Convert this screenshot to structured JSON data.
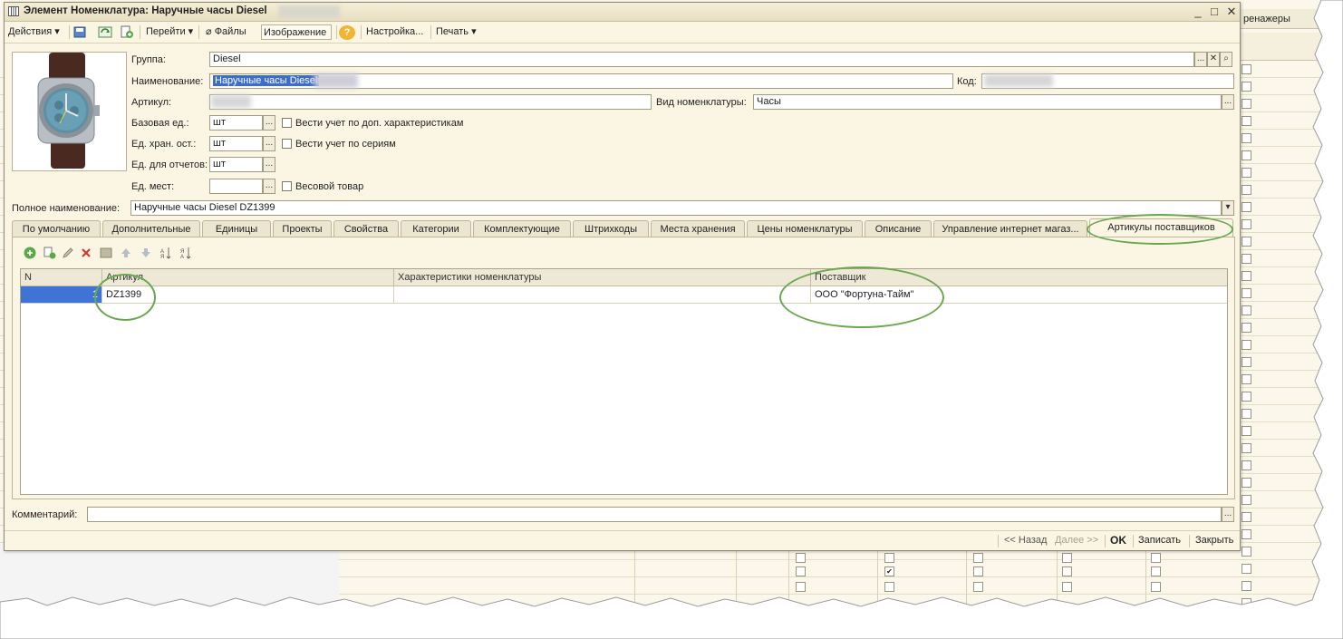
{
  "window": {
    "title": "Элемент Номенклатура: Наручные часы Diesel",
    "minimize": "_",
    "maximize": "□",
    "close": "✕"
  },
  "background": {
    "column_header": "ренажеры"
  },
  "toolbar": {
    "actions": "Действия",
    "goto": "Перейти",
    "files": "Файлы",
    "image": "Изображение",
    "help": "?",
    "settings": "Настройка...",
    "print": "Печать"
  },
  "form": {
    "group_label": "Группа:",
    "group_value": "Diesel",
    "name_label": "Наименование:",
    "name_value": "Наручные часы Diesel",
    "code_label": "Код:",
    "article_label": "Артикул:",
    "kind_label": "Вид номенклатуры:",
    "kind_value": "Часы",
    "base_unit_label": "Базовая ед.:",
    "base_unit_value": "шт",
    "storage_unit_label": "Ед. хран. ост.:",
    "storage_unit_value": "шт",
    "report_unit_label": "Ед. для отчетов:",
    "report_unit_value": "шт",
    "places_unit_label": "Ед. мест:",
    "places_unit_value": "",
    "cb_extra_chars": "Вести учет по доп. характеристикам",
    "cb_series": "Вести учет по сериям",
    "cb_weight": "Весовой товар",
    "fullname_label": "Полное наименование:",
    "fullname_value": "Наручные часы Diesel DZ1399",
    "comment_label": "Комментарий:",
    "comment_value": ""
  },
  "tabs": [
    "По умолчанию",
    "Дополнительные",
    "Единицы",
    "Проекты",
    "Свойства",
    "Категории",
    "Комплектующие",
    "Штрихкоды",
    "Места хранения",
    "Цены номенклатуры",
    "Описание",
    "Управление интернет магаз...",
    "Артикулы поставщиков"
  ],
  "active_tab": "Артикулы поставщиков",
  "grid": {
    "headers": [
      "N",
      "Артикул",
      "Характеристики номенклатуры",
      "Поставщик"
    ],
    "rows": [
      [
        "1",
        "DZ1399",
        "",
        "ООО \"Фортуна-Тайм\""
      ]
    ]
  },
  "bottom": {
    "back": "<< Назад",
    "next": "Далее >>",
    "ok": "OK",
    "save": "Записать",
    "close": "Закрыть"
  },
  "colors": {
    "window_bg": "#fbf6e4",
    "selection": "#3b6ec9",
    "annotation": "#6aa84f"
  }
}
